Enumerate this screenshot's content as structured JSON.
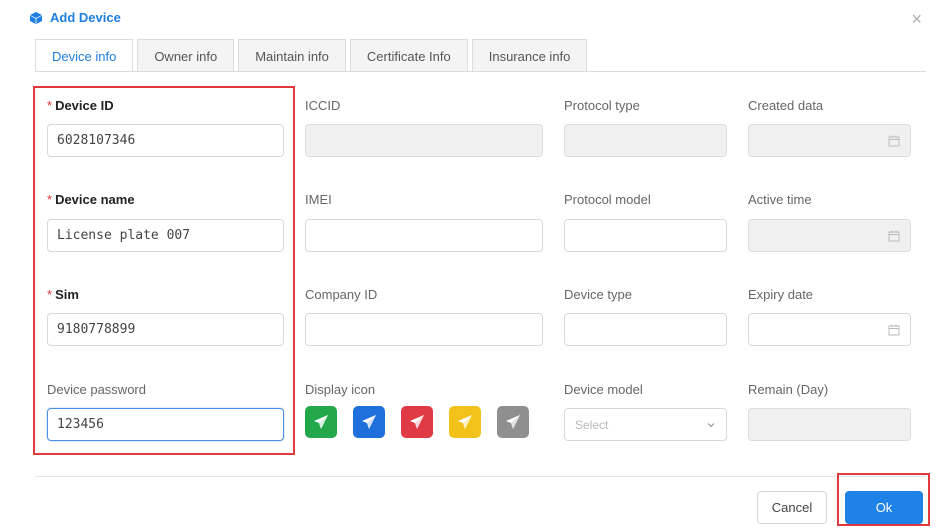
{
  "dialog": {
    "title": "Add Device",
    "close_symbol": "×",
    "title_icon": "cube-icon",
    "accent_color": "#1f7fe0"
  },
  "tabs": [
    {
      "label": "Device info",
      "active": true
    },
    {
      "label": "Owner info",
      "active": false
    },
    {
      "label": "Maintain info",
      "active": false
    },
    {
      "label": "Certificate Info",
      "active": false
    },
    {
      "label": "Insurance info",
      "active": false
    }
  ],
  "fields": {
    "device_id": {
      "label": "Device ID",
      "required_mark": "*",
      "value": "6028107346"
    },
    "device_name": {
      "label": "Device name",
      "required_mark": "*",
      "value": "License plate 007"
    },
    "sim": {
      "label": "Sim",
      "required_mark": "*",
      "value": "9180778899"
    },
    "device_password": {
      "label": "Device password",
      "value": "123456"
    },
    "iccid": {
      "label": "ICCID",
      "value": ""
    },
    "imei": {
      "label": "IMEI",
      "value": ""
    },
    "company_id": {
      "label": "Company ID",
      "value": ""
    },
    "display_icon": {
      "label": "Display icon"
    },
    "protocol_type": {
      "label": "Protocol type",
      "value": ""
    },
    "protocol_model": {
      "label": "Protocol model",
      "value": ""
    },
    "device_type": {
      "label": "Device type",
      "value": ""
    },
    "device_model": {
      "label": "Device model",
      "placeholder": "Select"
    },
    "created_data": {
      "label": "Created data",
      "value": ""
    },
    "active_time": {
      "label": "Active time",
      "value": ""
    },
    "expiry_date": {
      "label": "Expiry date",
      "value": ""
    },
    "remain_day": {
      "label": "Remain (Day)",
      "value": ""
    }
  },
  "display_icons": [
    {
      "name": "green",
      "color": "#22a84a"
    },
    {
      "name": "blue",
      "color": "#1f6fdc"
    },
    {
      "name": "red",
      "color": "#e03a45"
    },
    {
      "name": "yellow",
      "color": "#f2c21b"
    },
    {
      "name": "gray",
      "color": "#8f8f8f"
    }
  ],
  "footer": {
    "cancel_label": "Cancel",
    "ok_label": "Ok"
  }
}
